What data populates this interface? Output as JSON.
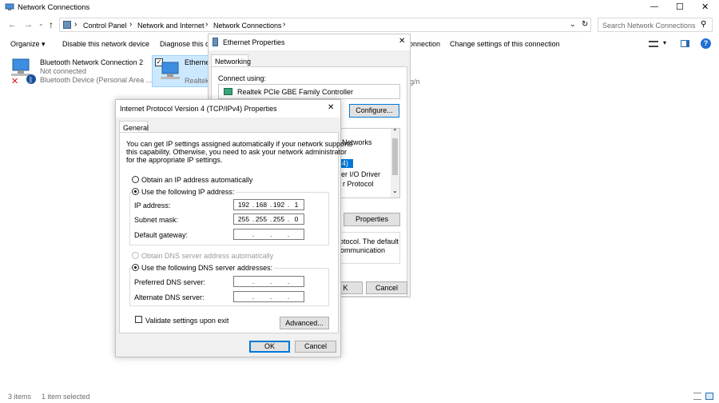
{
  "window": {
    "title": "Network Connections",
    "minimize": "—",
    "maximize": "☐",
    "close": "✕"
  },
  "address": {
    "back": "←",
    "forward": "→",
    "up": "↑",
    "crumbs": [
      "Control Panel",
      "Network and Internet",
      "Network Connections"
    ],
    "sep": "›",
    "search_placeholder": "Search Network Connections"
  },
  "toolbar": {
    "organize": "Organize ▾",
    "disable": "Disable this network device",
    "diagnose": "Diagnose this c",
    "rename": "onnection",
    "change": "Change settings of this connection"
  },
  "connections": [
    {
      "name": "Bluetooth Network Connection 2",
      "status": "Not connected",
      "device": "Bluetooth Device (Personal Area ..."
    },
    {
      "name": "Etherne",
      "status": "",
      "device": "Realtek"
    }
  ],
  "partial_right": "g/n",
  "statusbar": {
    "items": "3 items",
    "selected": "1 item selected"
  },
  "eth_dialog": {
    "title": "Ethernet Properties",
    "close": "✕",
    "tab": "Networking",
    "connect_using": "Connect using:",
    "adapter": "Realtek PCIe GBE Family Controller",
    "configure": "Configure...",
    "list_items": [
      "Networks",
      "4)",
      "er I/O Driver",
      "r Protocol"
    ],
    "properties": "Properties",
    "description": [
      "otocol. The default",
      "ommunication"
    ],
    "ok": "K",
    "cancel": "Cancel"
  },
  "ipv4": {
    "title": "Internet Protocol Version 4 (TCP/IPv4) Properties",
    "close": "✕",
    "tab": "General",
    "intro": [
      "You can get IP settings assigned automatically if your network supports",
      "this capability. Otherwise, you need to ask your network administrator",
      "for the appropriate IP settings."
    ],
    "auto_ip": "Obtain an IP address automatically",
    "manual_ip": "Use the following IP address:",
    "ip_label": "IP address:",
    "ip": [
      "192",
      "168",
      "192",
      "1"
    ],
    "mask_label": "Subnet mask:",
    "mask": [
      "255",
      "255",
      "255",
      "0"
    ],
    "gateway_label": "Default gateway:",
    "auto_dns": "Obtain DNS server address automatically",
    "manual_dns": "Use the following DNS server addresses:",
    "pref_dns": "Preferred DNS server:",
    "alt_dns": "Alternate DNS server:",
    "validate": "Validate settings upon exit",
    "advanced": "Advanced...",
    "ok": "OK",
    "cancel": "Cancel",
    "dot": "."
  }
}
